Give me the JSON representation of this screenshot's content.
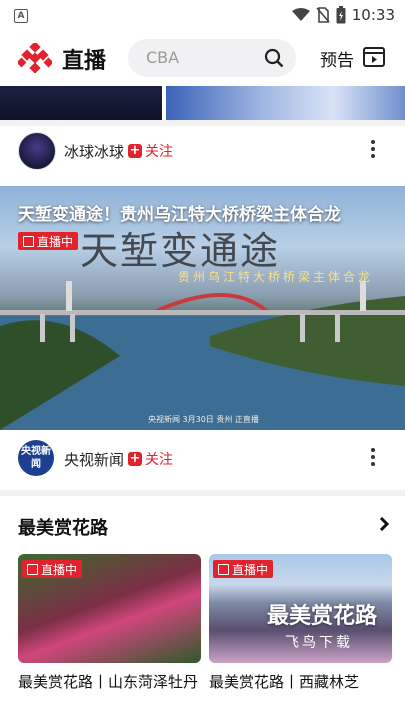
{
  "status": {
    "app_icon": "A",
    "time": "10:33",
    "icons": [
      "wifi-icon",
      "no-sim-icon",
      "battery-charging-icon"
    ]
  },
  "header": {
    "title": "直播",
    "search_placeholder": "CBA",
    "preview_label": "预告"
  },
  "feed": [
    {
      "author": "冰球冰球",
      "follow_label": "关注",
      "video_title": "天堑变通途！贵州乌江特大桥桥梁主体合龙",
      "live_label": "直播中",
      "overlay_calligraphy": "天堑变通途",
      "overlay_subtitle": "贵州乌江特大桥桥梁主体合龙",
      "watermark": "央视新闻 3月30日 贵州 正直播"
    },
    {
      "author": "央视新闻",
      "avatar_text": "央视新闻",
      "follow_label": "关注"
    }
  ],
  "section": {
    "title": "最美赏花路",
    "cards": [
      {
        "live_label": "直播中",
        "caption": "最美赏花路丨山东菏泽牡丹"
      },
      {
        "live_label": "直播中",
        "caption": "最美赏花路丨西藏林芝",
        "overlay_title": "最美赏花路",
        "overlay_sub": "飞鸟下载"
      }
    ]
  },
  "colors": {
    "accent": "#e0232d",
    "text": "#222222",
    "muted": "#999999"
  }
}
